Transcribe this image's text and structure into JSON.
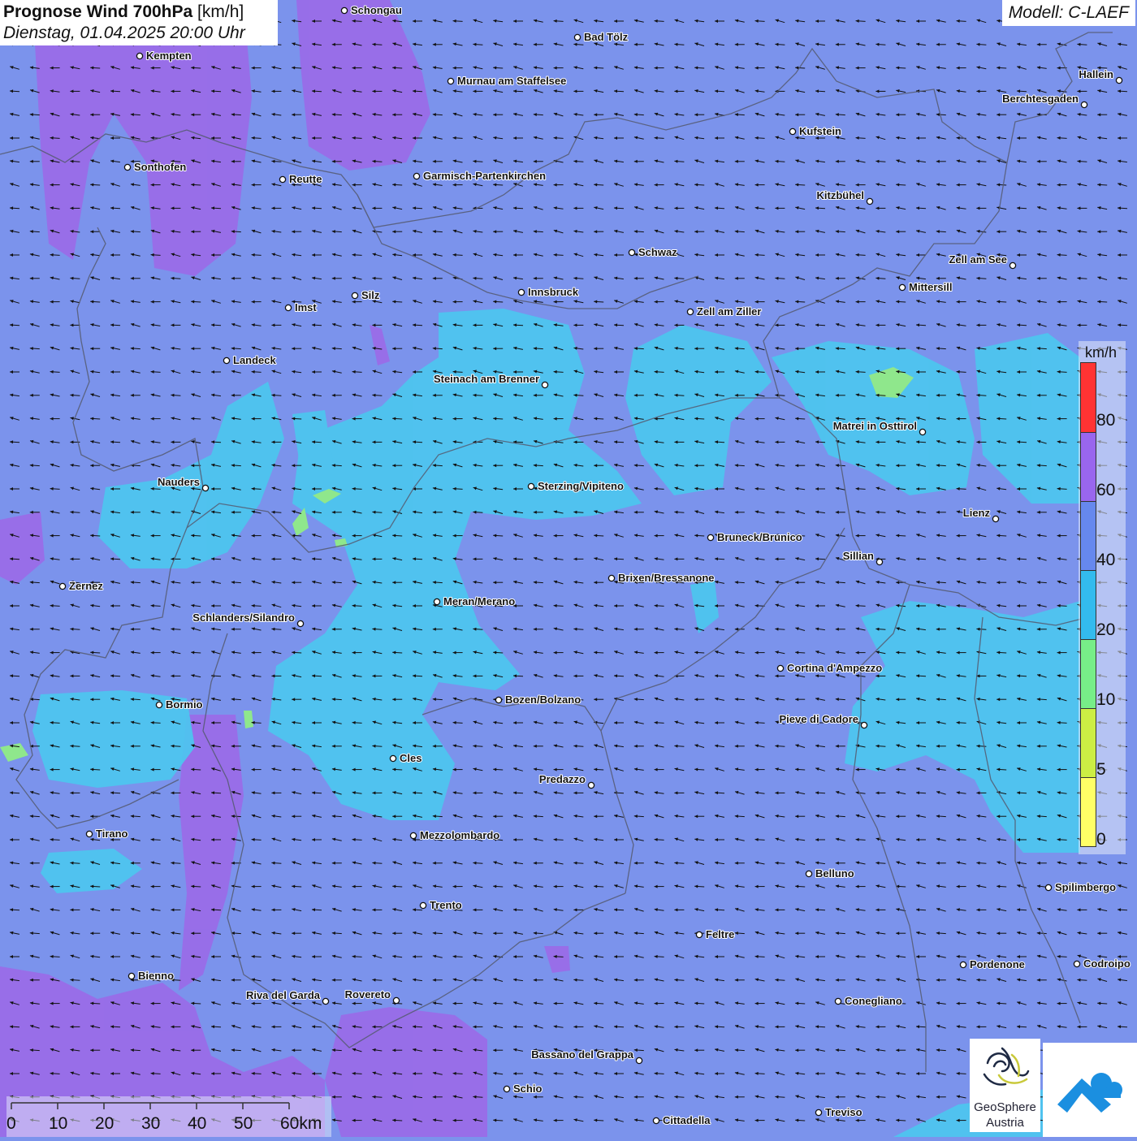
{
  "header": {
    "title_bold": "Prognose Wind 700hPa",
    "title_unit": "[km/h]",
    "date": "Dienstag, 01.04.2025 20:00 Uhr",
    "model": "Modell: C-LAEF"
  },
  "legend": {
    "unit": "km/h",
    "ticks": [
      "80",
      "60",
      "40",
      "20",
      "10",
      "5",
      "0"
    ],
    "colors": [
      "#ff3333",
      "#9966ee",
      "#6688ee",
      "#33bbee",
      "#77ee88",
      "#ccee44",
      "#ffff66"
    ]
  },
  "scalebar": {
    "labels": [
      "0",
      "10",
      "20",
      "30",
      "40",
      "50",
      "60km"
    ]
  },
  "logos": {
    "geosphere_line1": "GeoSphere",
    "geosphere_line2": "Austria"
  },
  "colors": {
    "background": "#7b93ec",
    "wind_20_40": "#4cc6ef",
    "wind_10_20": "#8fe78c",
    "wind_60_80": "#9b6ae8",
    "border": "#555a70"
  },
  "cities": [
    {
      "name": "Schongau",
      "label_side": "right"
    },
    {
      "name": "Bad Tölz",
      "label_side": "right"
    },
    {
      "name": "Kempten",
      "label_side": "right"
    },
    {
      "name": "Murnau am Staffelsee",
      "label_side": "right"
    },
    {
      "name": "Hallein",
      "label_side": "left"
    },
    {
      "name": "Berchtesgaden",
      "label_side": "left"
    },
    {
      "name": "Kufstein",
      "label_side": "right"
    },
    {
      "name": "Sonthofen",
      "label_side": "right"
    },
    {
      "name": "Reutte",
      "label_side": "right"
    },
    {
      "name": "Garmisch-Partenkirchen",
      "label_side": "right"
    },
    {
      "name": "Kitzbühel",
      "label_side": "left"
    },
    {
      "name": "Schwaz",
      "label_side": "right"
    },
    {
      "name": "Zell am See",
      "label_side": "left"
    },
    {
      "name": "Mittersill",
      "label_side": "right"
    },
    {
      "name": "Imst",
      "label_side": "right"
    },
    {
      "name": "Silz",
      "label_side": "right"
    },
    {
      "name": "Innsbruck",
      "label_side": "right"
    },
    {
      "name": "Zell am Ziller",
      "label_side": "right"
    },
    {
      "name": "Landeck",
      "label_side": "right"
    },
    {
      "name": "Steinach am Brenner",
      "label_side": "left"
    },
    {
      "name": "Matrei in Osttirol",
      "label_side": "left"
    },
    {
      "name": "Nauders",
      "label_side": "left"
    },
    {
      "name": "Sterzing/Vipiteno",
      "label_side": "right"
    },
    {
      "name": "Lienz",
      "label_side": "left"
    },
    {
      "name": "Bruneck/Brunico",
      "label_side": "right"
    },
    {
      "name": "Sillian",
      "label_side": "left"
    },
    {
      "name": "Zernez",
      "label_side": "right"
    },
    {
      "name": "Brixen/Bressanone",
      "label_side": "right"
    },
    {
      "name": "Meran/Merano",
      "label_side": "right"
    },
    {
      "name": "Schlanders/Silandro",
      "label_side": "left"
    },
    {
      "name": "Cortina d'Ampezzo",
      "label_side": "right"
    },
    {
      "name": "Bozen/Bolzano",
      "label_side": "right"
    },
    {
      "name": "Bormio",
      "label_side": "right"
    },
    {
      "name": "Pieve di Cadore",
      "label_side": "left"
    },
    {
      "name": "Cles",
      "label_side": "right"
    },
    {
      "name": "Predazzo",
      "label_side": "left"
    },
    {
      "name": "Tirano",
      "label_side": "right"
    },
    {
      "name": "Mezzolombardo",
      "label_side": "right"
    },
    {
      "name": "Belluno",
      "label_side": "right"
    },
    {
      "name": "Spilimbergo",
      "label_side": "right"
    },
    {
      "name": "Trento",
      "label_side": "right"
    },
    {
      "name": "Feltre",
      "label_side": "right"
    },
    {
      "name": "Pordenone",
      "label_side": "right"
    },
    {
      "name": "Codroipo",
      "label_side": "right"
    },
    {
      "name": "Bienno",
      "label_side": "right"
    },
    {
      "name": "Riva del Garda",
      "label_side": "left"
    },
    {
      "name": "Rovereto",
      "label_side": "left"
    },
    {
      "name": "Conegliano",
      "label_side": "right"
    },
    {
      "name": "Bassano del Grappa",
      "label_side": "left"
    },
    {
      "name": "Schio",
      "label_side": "right"
    },
    {
      "name": "Treviso",
      "label_side": "right"
    },
    {
      "name": "Cittadella",
      "label_side": "right"
    }
  ]
}
